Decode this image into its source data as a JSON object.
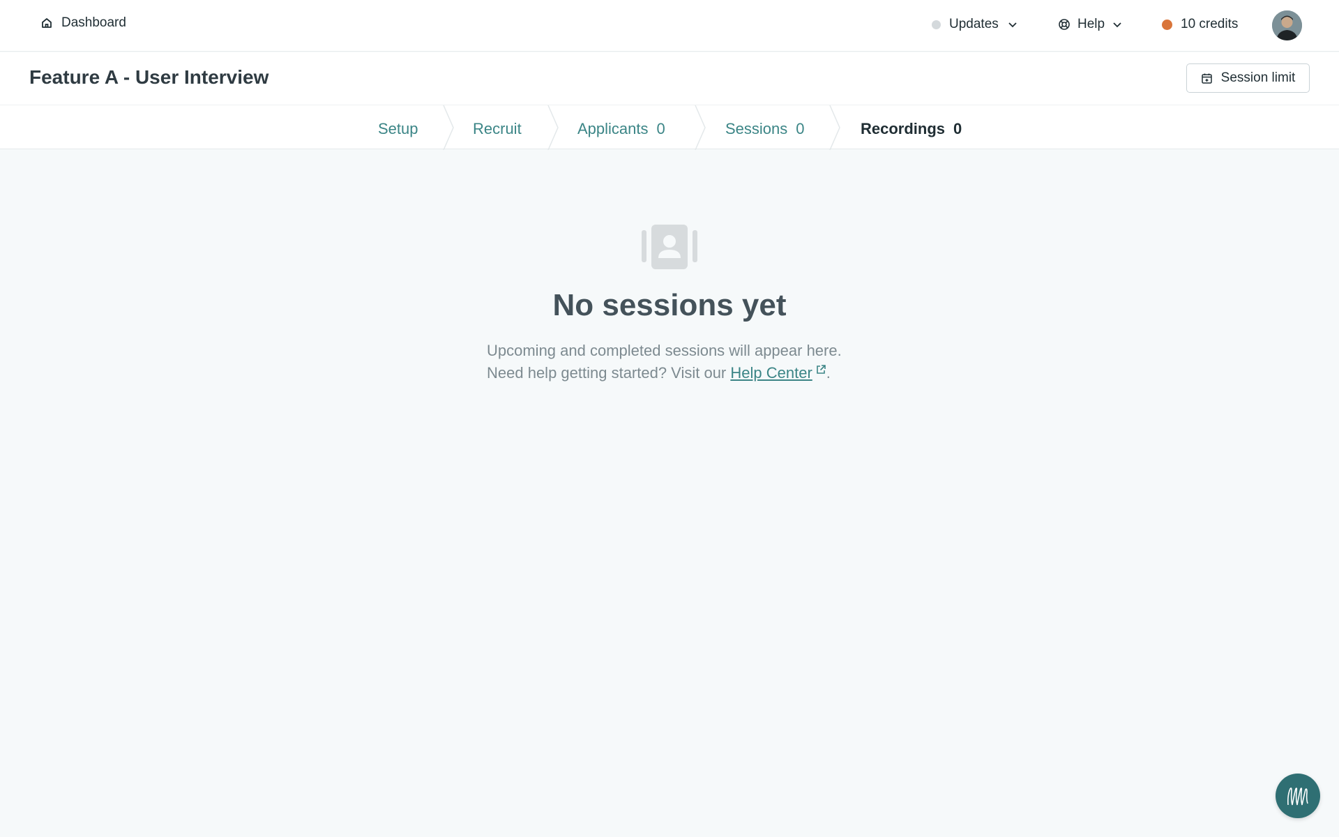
{
  "topbar": {
    "dashboard_label": "Dashboard",
    "updates_label": "Updates",
    "help_label": "Help",
    "credits_label": "10 credits"
  },
  "header": {
    "title": "Feature A - User Interview",
    "session_limit_label": "Session limit"
  },
  "tabs": [
    {
      "label": "Setup",
      "count": "",
      "active": false
    },
    {
      "label": "Recruit",
      "count": "",
      "active": false
    },
    {
      "label": "Applicants",
      "count": "0",
      "active": false
    },
    {
      "label": "Sessions",
      "count": "0",
      "active": false
    },
    {
      "label": "Recordings",
      "count": "0",
      "active": true
    }
  ],
  "empty_state": {
    "title": "No sessions yet",
    "line1": "Upcoming and completed sessions will appear here.",
    "line2_prefix": "Need help getting started? Visit our ",
    "help_link": "Help Center",
    "line2_suffix": "."
  },
  "colors": {
    "accent": "#3b8586",
    "credits_dot": "#d9753a",
    "background": "#f6f9fa"
  },
  "icons": [
    "home-icon",
    "chevron-down-icon",
    "lifebuoy-icon",
    "calendar-icon",
    "contact-book-icon",
    "external-link-icon",
    "chat-icon"
  ]
}
